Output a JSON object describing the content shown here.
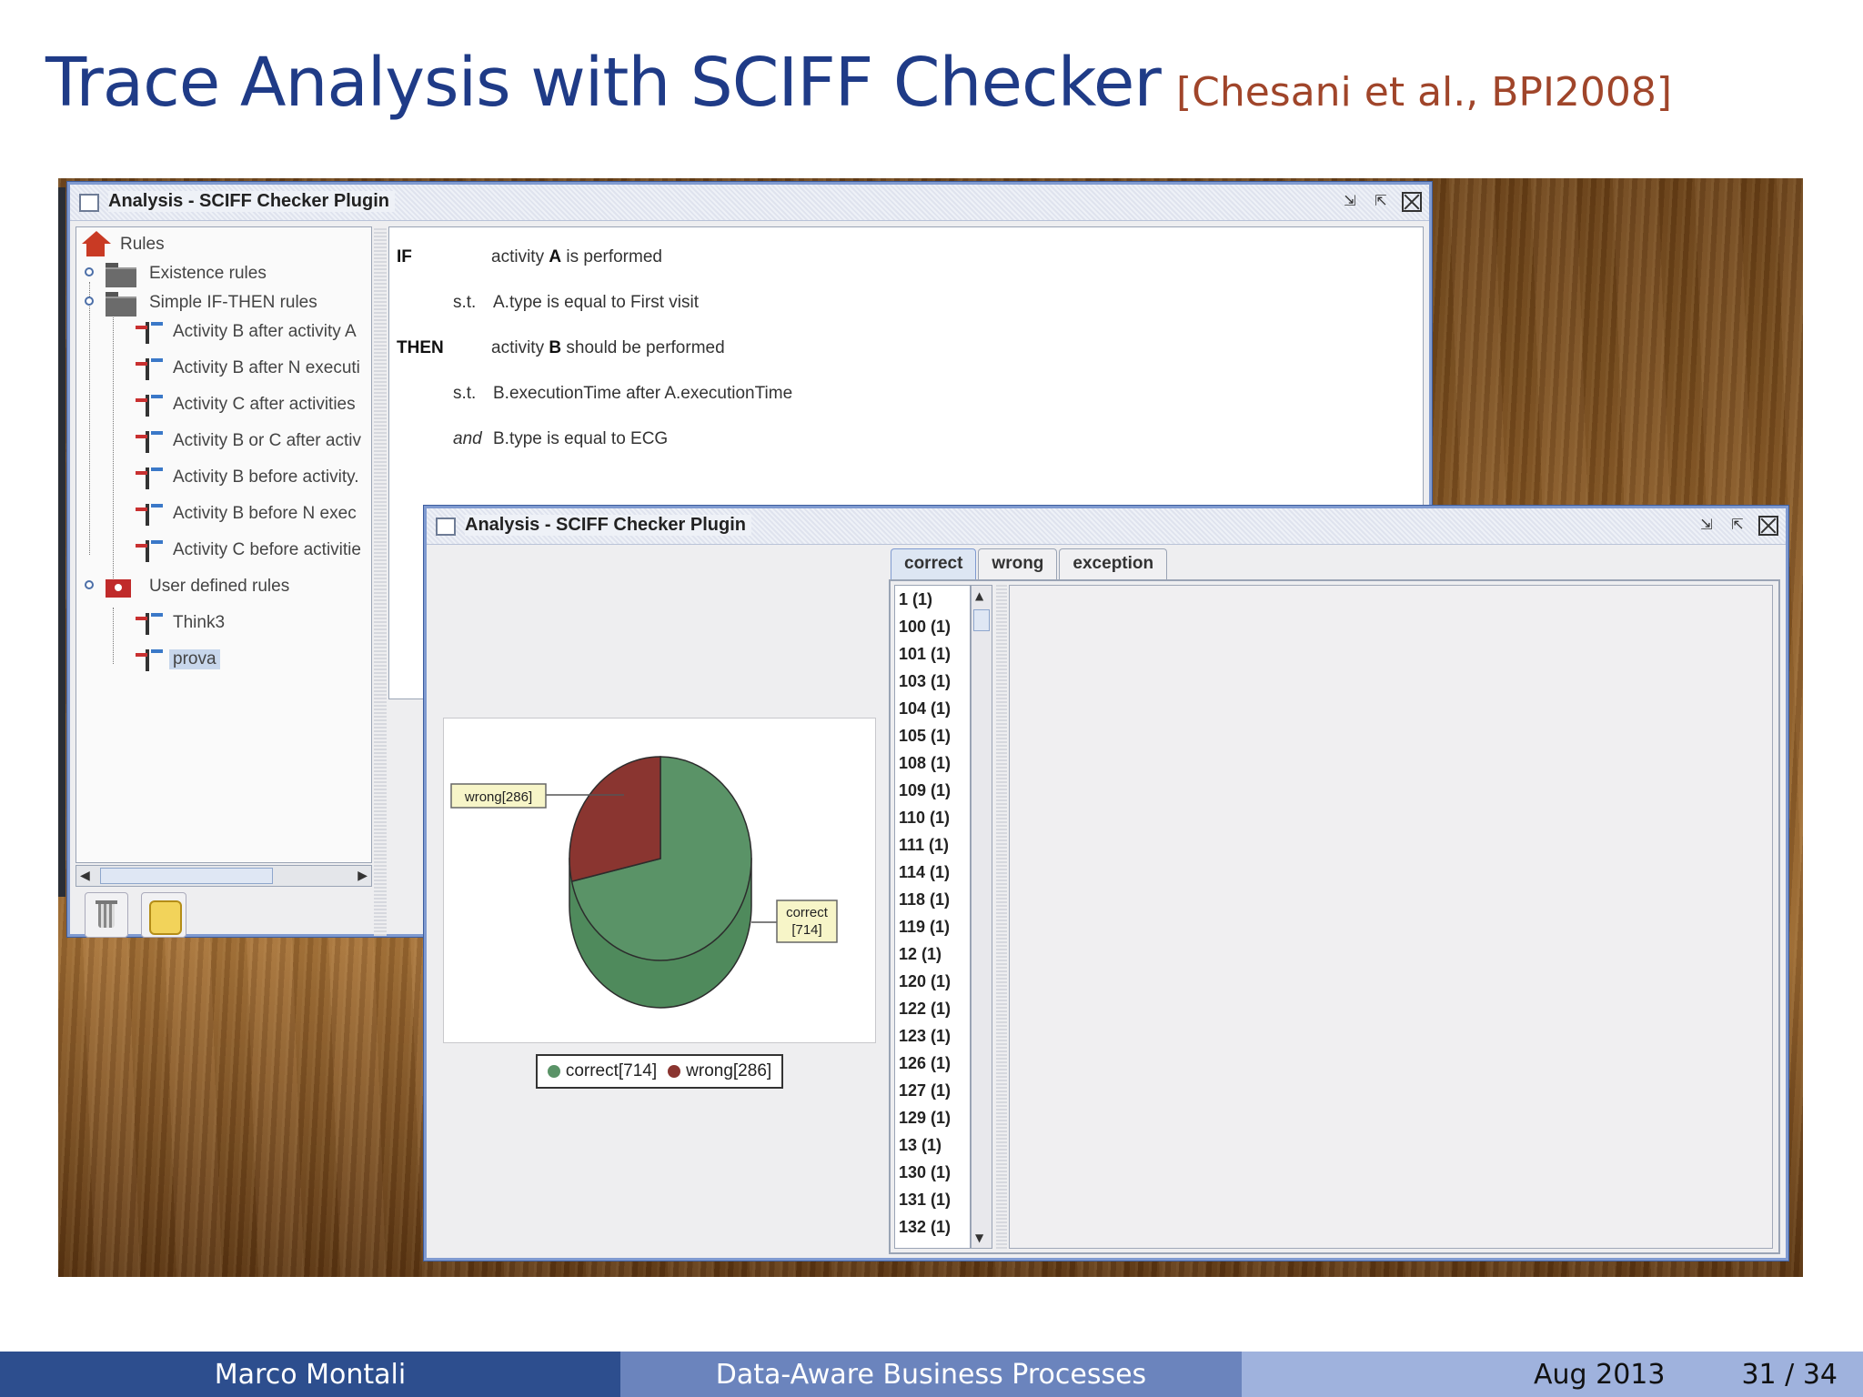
{
  "slide": {
    "title": "Trace Analysis with SCIFF Checker",
    "citation": "[Chesani et al., BPI2008]"
  },
  "window_rules": {
    "title": "Analysis - SCIFF Checker Plugin",
    "tree": {
      "root": "Rules",
      "existence": "Existence rules",
      "simple": "Simple IF-THEN rules",
      "simple_items": [
        "Activity B after activity A",
        "Activity B after N executi",
        "Activity C after activities",
        "Activity B or C after activ",
        "Activity B before activity.",
        "Activity B before N exec",
        "Activity C before activitie"
      ],
      "user_defined": "User defined rules",
      "user_items": [
        "Think3",
        "prova"
      ]
    },
    "rule": {
      "if_kw": "IF",
      "if_pre": "activity",
      "if_act": "A",
      "if_post": "is performed",
      "st1_kw": "s.t.",
      "st1_text": "A.type is equal to First visit",
      "then_kw": "THEN",
      "then_pre": "activity",
      "then_act": "B",
      "then_post": "should be performed",
      "st2_kw": "s.t.",
      "st2_text": "B.executionTime after A.executionTime",
      "and_kw": "and",
      "and_text": "B.type is equal to ECG"
    }
  },
  "window_results": {
    "title": "Analysis - SCIFF Checker Plugin",
    "tabs": [
      "correct",
      "wrong",
      "exception"
    ],
    "active_tab": "correct",
    "traces": [
      "1 (1)",
      "100 (1)",
      "101 (1)",
      "103 (1)",
      "104 (1)",
      "105 (1)",
      "108 (1)",
      "109 (1)",
      "110 (1)",
      "111 (1)",
      "114 (1)",
      "118 (1)",
      "119 (1)",
      "12 (1)",
      "120 (1)",
      "122 (1)",
      "123 (1)",
      "126 (1)",
      "127 (1)",
      "129 (1)",
      "13 (1)",
      "130 (1)",
      "131 (1)",
      "132 (1)"
    ],
    "legend_correct": "correct[714]",
    "legend_wrong": "wrong[286]"
  },
  "chart_data": {
    "type": "pie",
    "categories": [
      "correct",
      "wrong"
    ],
    "values": [
      714,
      286
    ],
    "labels": [
      "correct\n[714]",
      "wrong[286]"
    ],
    "colors": [
      "#5a9367",
      "#8a3530"
    ],
    "legend": "bottom"
  },
  "footer": {
    "author": "Marco Montali",
    "talk": "Data-Aware Business Processes",
    "date": "Aug 2013",
    "page": "31 / 34"
  }
}
